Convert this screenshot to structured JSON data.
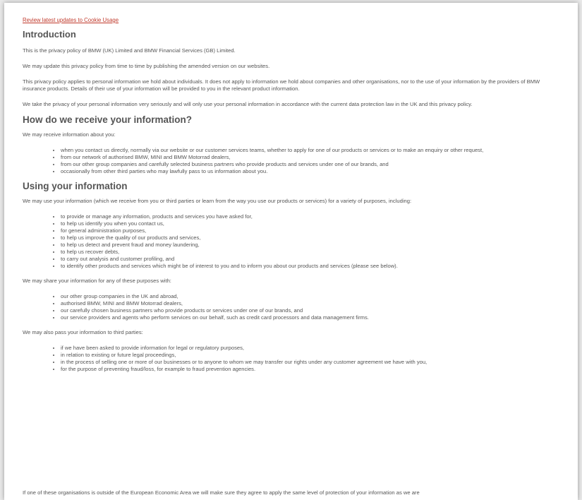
{
  "top_link": "Review latest updates to Cookie Usage",
  "intro": {
    "heading": "Introduction",
    "paragraphs": [
      "This is the privacy policy of BMW (UK) Limited and BMW Financial Services (GB) Limited.",
      "We may update this privacy policy from time to time by publishing the amended version on our websites.",
      "This privacy policy applies to personal information we hold about individuals. It does not apply to information we hold about companies and other organisations, nor to the use of your information by the providers of BMW insurance products. Details of their use of your information will be provided to you in the relevant product information.",
      "We take the privacy of your personal information very seriously and will only use your personal information in accordance with the current data protection law in the UK and this privacy policy."
    ]
  },
  "receive": {
    "heading": "How do we receive your information?",
    "lead": "We may receive information about you:",
    "items": [
      "when you contact us directly, normally via our website or our customer services teams, whether to apply for one of our products or services or to make an enquiry or other request,",
      "from our network of authorised BMW, MINI and BMW Motorrad dealers,",
      "from our other group companies and carefully selected business partners who provide products and services under one of our brands, and",
      "occasionally from other third parties who may lawfully pass to us information about you."
    ]
  },
  "using": {
    "heading": "Using your information",
    "lead": "We may use your information (which we receive from you or third parties or learn from the way you use our products or services) for a variety of purposes, including:",
    "items": [
      "to provide or manage any information, products and services you have asked for,",
      "to help us identify you when you contact us,",
      "for general administration purposes,",
      "to help us improve the quality of our products and services,",
      "to help us detect and prevent fraud and money laundering,",
      "to help us recover debts,",
      "to carry out analysis and customer profiling, and",
      "to identify other products and services which might be of interest to you and to inform you about our products and services (please see below)."
    ],
    "share_lead": "We may share your information for any of these purposes with:",
    "share_items": [
      "our other group companies in the UK and abroad,",
      "authorised BMW, MINI and BMW Motorrad dealers,",
      "our carefully chosen business partners who provide products or services under one of our brands, and",
      "our service providers and agents who perform services on our behalf, such as credit card processors and data management firms."
    ],
    "third_lead": "We may also pass your information to third parties:",
    "third_items": [
      "if we have been asked to provide information for legal or regulatory purposes,",
      "in relation to existing or future legal proceedings,",
      "in the process of selling one or more of our businesses or to anyone to whom we may transfer our rights under any customer agreement we have with you,",
      "for the purpose of preventing fraud/loss, for example to fraud prevention agencies."
    ],
    "cutoff": "If one of these organisations is outside of the European Economic Area we will make sure they agree to apply the same level of protection of your information as we are"
  }
}
